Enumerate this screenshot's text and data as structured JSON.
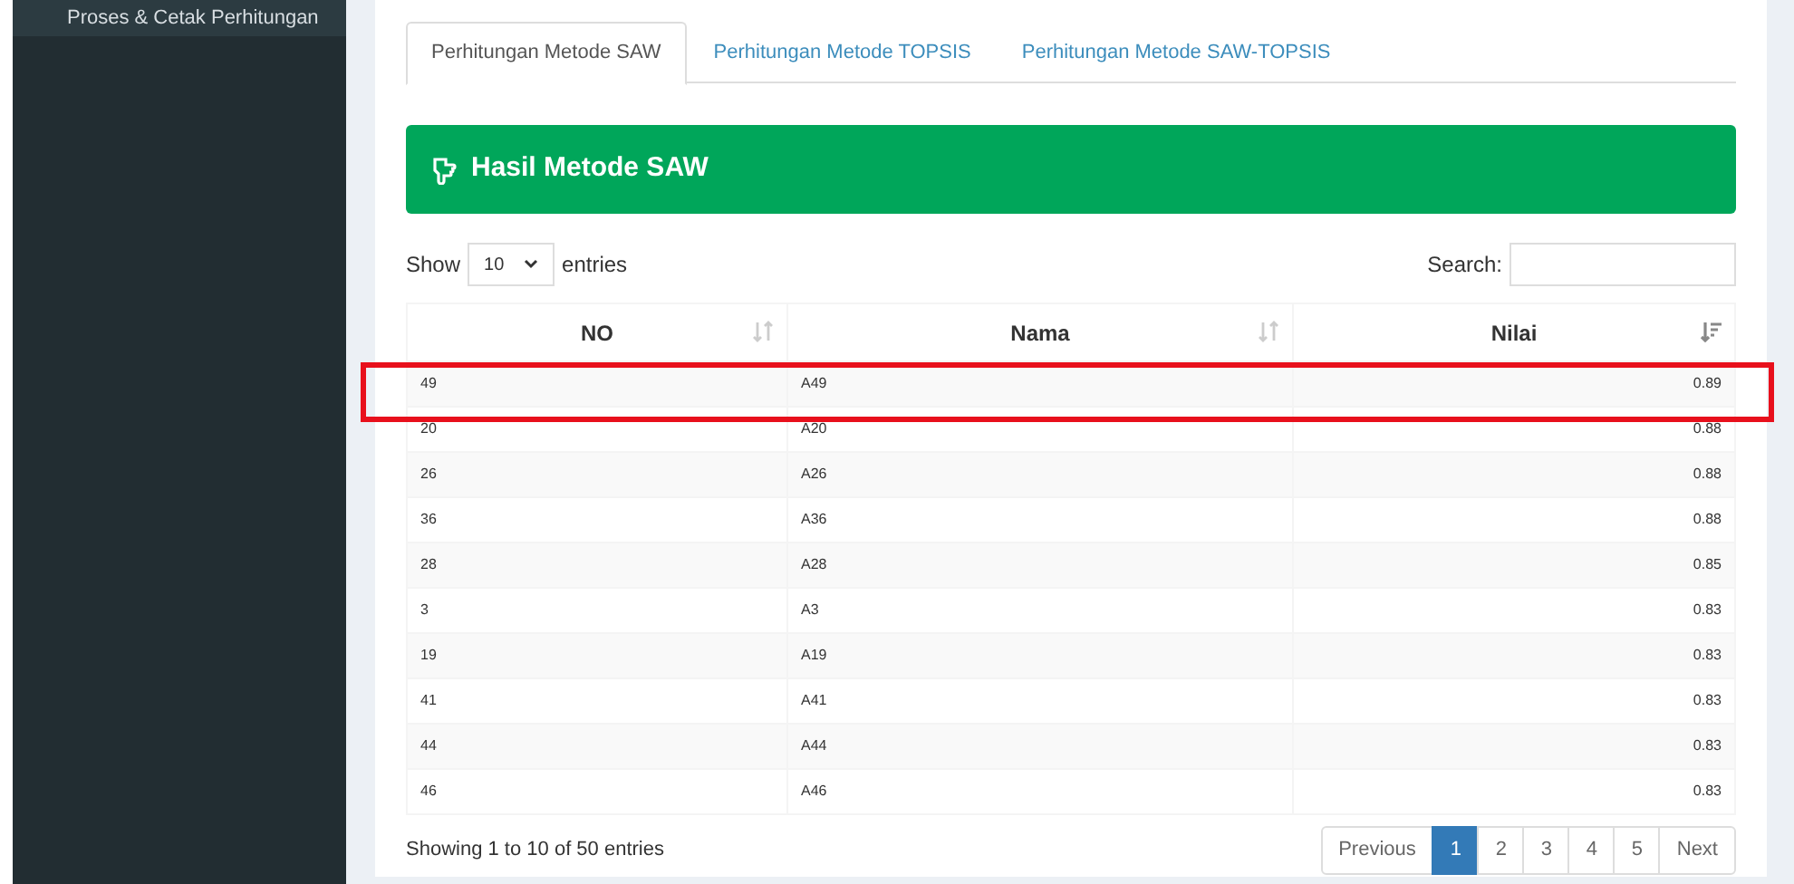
{
  "sidebar": {
    "items": [
      {
        "label": "Proses & Cetak Perhitungan",
        "selected": true
      }
    ]
  },
  "tabs": [
    {
      "label": "Perhitungan Metode SAW",
      "selected": true
    },
    {
      "label": "Perhitungan Metode TOPSIS",
      "selected": false
    },
    {
      "label": "Perhitungan Metode SAW-TOPSIS",
      "selected": false
    }
  ],
  "banner": {
    "title": "Hasil Metode SAW"
  },
  "length_menu": {
    "before": "Show",
    "value": "10",
    "after": "entries"
  },
  "search": {
    "label": "Search:"
  },
  "table": {
    "columns": [
      {
        "label": "NO",
        "sorted": false
      },
      {
        "label": "Nama",
        "sorted": false
      },
      {
        "label": "Nilai",
        "sorted": true
      }
    ],
    "rows": [
      {
        "cells": [
          "49",
          "A49",
          "0.89"
        ],
        "highlighted": true
      },
      {
        "cells": [
          "20",
          "A20",
          "0.88"
        ],
        "highlighted": false
      },
      {
        "cells": [
          "26",
          "A26",
          "0.88"
        ],
        "highlighted": false
      },
      {
        "cells": [
          "36",
          "A36",
          "0.88"
        ],
        "highlighted": false
      },
      {
        "cells": [
          "28",
          "A28",
          "0.85"
        ],
        "highlighted": false
      },
      {
        "cells": [
          "3",
          "A3",
          "0.83"
        ],
        "highlighted": false
      },
      {
        "cells": [
          "19",
          "A19",
          "0.83"
        ],
        "highlighted": false
      },
      {
        "cells": [
          "41",
          "A41",
          "0.83"
        ],
        "highlighted": false
      },
      {
        "cells": [
          "44",
          "A44",
          "0.83"
        ],
        "highlighted": false
      },
      {
        "cells": [
          "46",
          "A46",
          "0.83"
        ],
        "highlighted": false
      }
    ]
  },
  "info": "Showing 1 to 10 of 50 entries",
  "pagination": [
    {
      "label": "Previous",
      "selected": false
    },
    {
      "label": "1",
      "selected": true
    },
    {
      "label": "2",
      "selected": false
    },
    {
      "label": "3",
      "selected": false
    },
    {
      "label": "4",
      "selected": false
    },
    {
      "label": "5",
      "selected": false
    },
    {
      "label": "Next",
      "selected": false
    }
  ]
}
